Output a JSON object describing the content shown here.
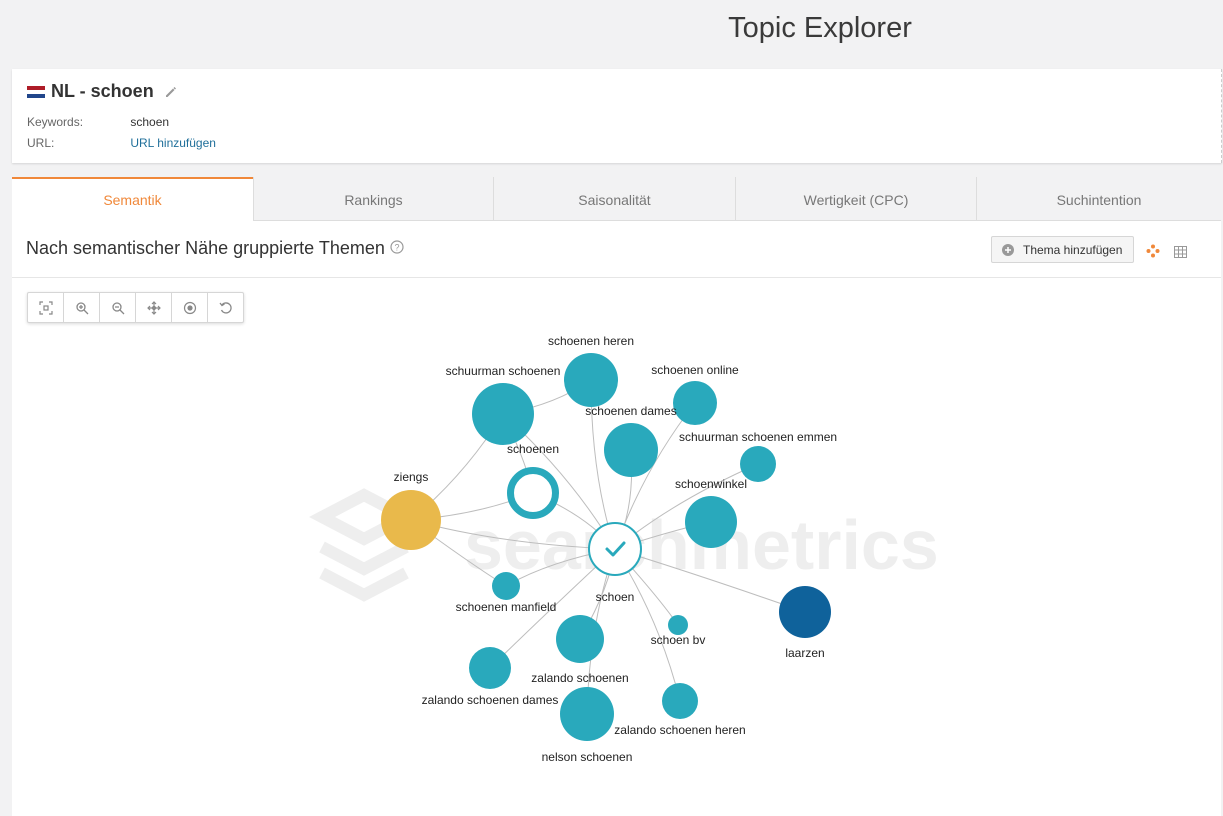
{
  "app": {
    "title": "Topic Explorer"
  },
  "project": {
    "title": "NL - schoen",
    "flag_colors": [
      "#ae1c28",
      "#ffffff",
      "#21468b"
    ],
    "keywords_label": "Keywords:",
    "keywords_value": "schoen",
    "url_label": "URL:",
    "url_link": "URL hinzufügen"
  },
  "tabs": [
    {
      "label": "Semantik",
      "active": true
    },
    {
      "label": "Rankings",
      "active": false
    },
    {
      "label": "Saisonalität",
      "active": false
    },
    {
      "label": "Wertigkeit (CPC)",
      "active": false
    },
    {
      "label": "Suchintention",
      "active": false
    }
  ],
  "section": {
    "title": "Nach semantischer Nähe gruppierte Themen",
    "add_topic_label": "Thema hinzufügen"
  },
  "toolbar": [
    "fit-icon",
    "zoom-in-icon",
    "zoom-out-icon",
    "pan-icon",
    "center-icon",
    "reset-icon"
  ],
  "graph": {
    "watermark": "searchmetrics",
    "center": {
      "label": "schoen"
    },
    "colors": {
      "topic": "#29a9bc",
      "highlight": "#e9b94b",
      "dark": "#0f629b",
      "edge": "#bdbdbd"
    },
    "nodes": [
      {
        "label": "schoenen heren",
        "color": "topic"
      },
      {
        "label": "schuurman schoenen",
        "color": "topic"
      },
      {
        "label": "schoenen online",
        "color": "topic"
      },
      {
        "label": "schoenen dames",
        "color": "topic"
      },
      {
        "label": "schuurman schoenen emmen",
        "color": "topic"
      },
      {
        "label": "schoenen",
        "color": "ring"
      },
      {
        "label": "ziengs",
        "color": "highlight"
      },
      {
        "label": "schoenwinkel",
        "color": "topic"
      },
      {
        "label": "schoenen manfield",
        "color": "topic"
      },
      {
        "label": "schoen bv",
        "color": "topic"
      },
      {
        "label": "laarzen",
        "color": "dark"
      },
      {
        "label": "zalando schoenen",
        "color": "topic"
      },
      {
        "label": "zalando schoenen dames",
        "color": "topic"
      },
      {
        "label": "zalando schoenen heren",
        "color": "topic"
      },
      {
        "label": "nelson schoenen",
        "color": "topic"
      }
    ]
  }
}
